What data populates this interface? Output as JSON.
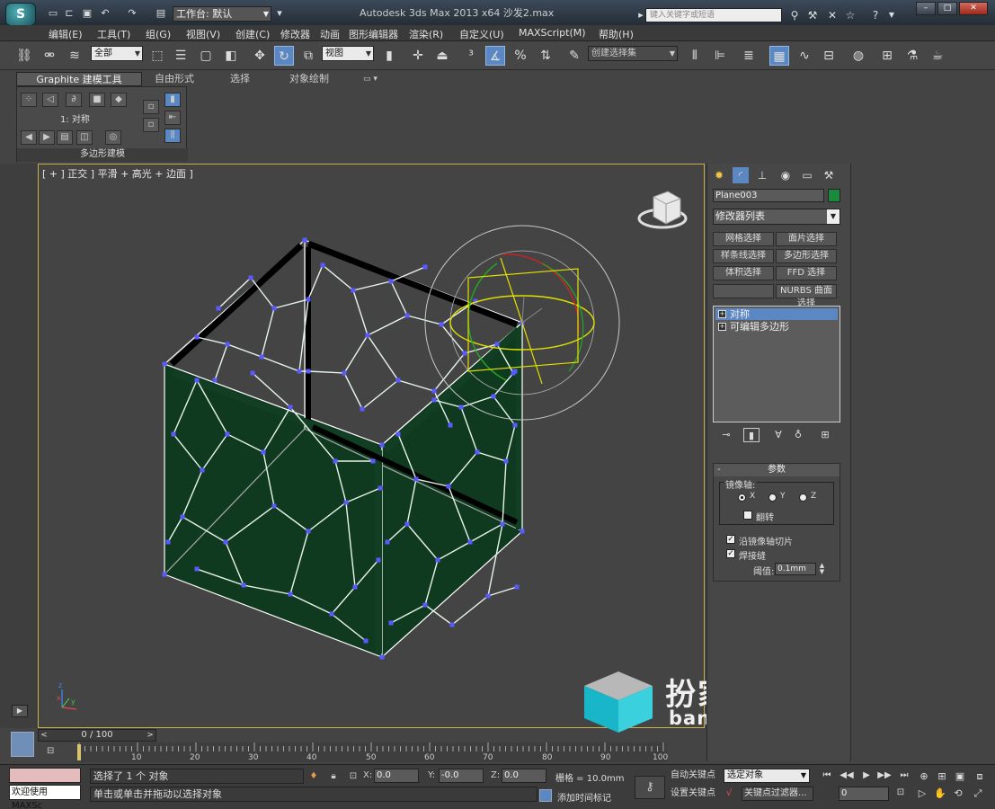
{
  "app": {
    "logo_text": "S",
    "title": "Autodesk 3ds Max  2013 x64       沙发2.max",
    "workspace": "工作台: 默认",
    "search_placeholder": "键入关键字或短语"
  },
  "menu": [
    "编辑(E)",
    "工具(T)",
    "组(G)",
    "视图(V)",
    "创建(C)",
    "修改器",
    "动画",
    "图形编辑器",
    "渲染(R)",
    "自定义(U)",
    "MAXScript(M)",
    "帮助(H)"
  ],
  "toolbar": {
    "selection_filter": "全部",
    "ref_coord": "视图",
    "named_selection": "创建选择集"
  },
  "ribbon": {
    "tabs": [
      "Graphite 建模工具",
      "自由形式",
      "选择",
      "对象绘制"
    ],
    "mirror_label": "1: 对称",
    "panel_title": "多边形建模"
  },
  "viewport": {
    "label": "[ + ] 正交 ] 平滑 + 高光 + 边面 ]",
    "border_color": "#c8b04a",
    "mesh_color": "#0f3a1f",
    "vertex_color": "#5a5aff"
  },
  "command_panel": {
    "object_name": "Plane003",
    "object_color": "#1a8a3c",
    "modifier_list": "修改器列表",
    "buttons": [
      "网格选择",
      "面片选择",
      "样条线选择",
      "多边形选择",
      "体积选择",
      "FFD 选择",
      "",
      "NURBS 曲面选择"
    ],
    "stack": [
      "对称",
      "可编辑多边形"
    ],
    "params_title": "参数",
    "mirror_axis_label": "镜像轴:",
    "axes": [
      "X",
      "Y",
      "Z"
    ],
    "selected_axis": "X",
    "flip_label": "翻转",
    "slice_label": "沿镜像轴切片",
    "weld_label": "焊接缝",
    "slice_checked": true,
    "weld_checked": true,
    "flip_checked": false,
    "threshold_label": "阈值:",
    "threshold_value": "0.1mm"
  },
  "timeline": {
    "frame_display": "0 / 100",
    "ticks": [
      "10",
      "20",
      "30",
      "40",
      "50",
      "60",
      "70",
      "80",
      "90",
      "100"
    ]
  },
  "status": {
    "maxscript_welcome": "欢迎使用 MAXSc",
    "selected_text": "选择了 1 个 对象",
    "prompt_text": "单击或单击并拖动以选择对象",
    "x_label": "X:",
    "y_label": "Y:",
    "z_label": "Z:",
    "x_value": "0.0",
    "y_value": "-0.0",
    "z_value": "0.0",
    "grid_text": "栅格 = 10.0mm",
    "add_time_tag": "添加时间标记",
    "auto_key": "自动关键点",
    "set_key": "设置关键点",
    "selected_object": "选定对象",
    "key_filter": "关键点过滤器...",
    "frame_value": "0"
  },
  "watermark": {
    "text": "扮家家室内设计",
    "url": "banjiajia.com"
  }
}
